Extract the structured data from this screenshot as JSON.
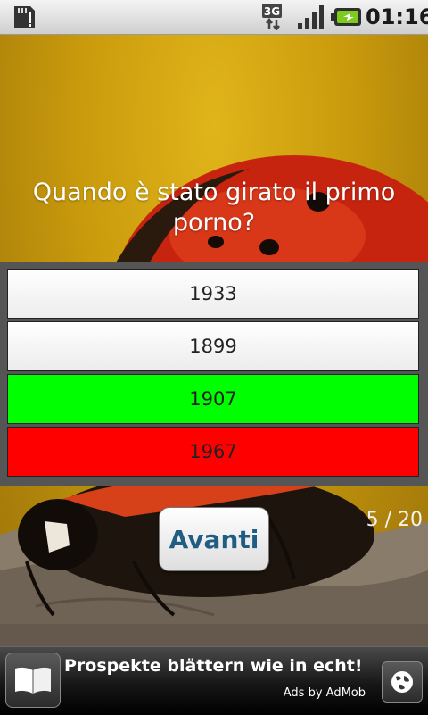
{
  "status_bar": {
    "network_label": "3G",
    "time": "01:16",
    "icons": [
      "sd-card-icon",
      "network-3g-icon",
      "signal-strength-icon",
      "battery-charging-icon"
    ]
  },
  "quiz": {
    "question": "Quando è stato girato il primo porno?",
    "answers": [
      {
        "label": "1933",
        "state": "neutral"
      },
      {
        "label": "1899",
        "state": "neutral"
      },
      {
        "label": "1907",
        "state": "correct"
      },
      {
        "label": "1967",
        "state": "wrong"
      }
    ],
    "next_label": "Avanti",
    "progress": "5 / 20"
  },
  "ad": {
    "text": "Prospekte blättern wie in echt!",
    "attribution": "Ads by AdMob",
    "icons": [
      "book-icon",
      "globe-icon"
    ]
  },
  "colors": {
    "correct": "#00ff00",
    "wrong": "#ff0000",
    "button_text": "#1f5d82",
    "panel": "#555555"
  }
}
